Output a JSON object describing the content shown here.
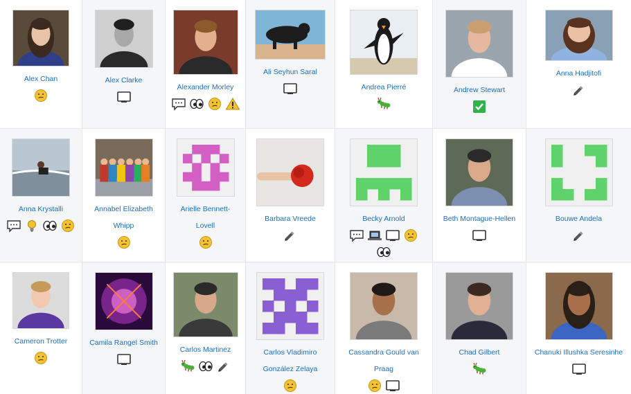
{
  "participants": [
    {
      "name": "Alex Chan",
      "icons": [
        "confused-face-icon"
      ]
    },
    {
      "name": "Alex Clarke",
      "icons": [
        "laptop-screen-icon"
      ]
    },
    {
      "name": "Alexander Morley",
      "icons": [
        "speech-bubble-icon",
        "eyes-icon",
        "confused-face-icon",
        "warning-icon"
      ]
    },
    {
      "name": "Ali Seyhun Saral",
      "icons": [
        "laptop-screen-icon"
      ]
    },
    {
      "name": "Andrea Pierré",
      "icons": [
        "bug-icon"
      ]
    },
    {
      "name": "Andrew Stewart",
      "icons": [
        "checkmark-icon"
      ]
    },
    {
      "name": "Anna Hadjitofi",
      "icons": [
        "pencil-icon"
      ]
    },
    {
      "name": "Anna Krystalli",
      "icons": [
        "speech-bubble-icon",
        "lightbulb-icon",
        "eyes-icon",
        "confused-face-icon"
      ]
    },
    {
      "name": "Annabel Elizabeth Whipp",
      "icons": [
        "confused-face-icon"
      ]
    },
    {
      "name": "Arielle Bennett-Lovell",
      "icons": [
        "confused-face-icon"
      ]
    },
    {
      "name": "Barbara Vreede",
      "icons": [
        "pencil-icon"
      ]
    },
    {
      "name": "Becky Arnold",
      "icons": [
        "speech-bubble-icon",
        "laptop-icon",
        "laptop-screen-icon",
        "confused-face-icon",
        "eyes-icon"
      ]
    },
    {
      "name": "Beth Montague-Hellen",
      "icons": [
        "laptop-screen-icon"
      ]
    },
    {
      "name": "Bouwe Andela",
      "icons": [
        "pencil-icon"
      ]
    },
    {
      "name": "Cameron Trotter",
      "icons": [
        "confused-face-icon"
      ]
    },
    {
      "name": "Camila Rangel Smith",
      "icons": [
        "laptop-screen-icon"
      ]
    },
    {
      "name": "Carlos Martinez",
      "icons": [
        "bug-icon",
        "eyes-icon",
        "pencil-icon"
      ]
    },
    {
      "name": "Carlos Vladimiro González Zelaya",
      "icons": [
        "confused-face-icon"
      ]
    },
    {
      "name": "Cassandra Gould van Praag",
      "icons": [
        "confused-face-icon",
        "laptop-screen-icon"
      ]
    },
    {
      "name": "Chad Gilbert",
      "icons": [
        "bug-icon"
      ]
    },
    {
      "name": "Chanuki Illushka Seresinhe",
      "icons": [
        "laptop-screen-icon"
      ]
    }
  ],
  "colors": {
    "link": "#1a6ec5",
    "identicon_pink": "#d35fc4",
    "identicon_green": "#5fd36a",
    "identicon_purple": "#8a5fd3",
    "check_green": "#2fb34a",
    "emoji_yellow": "#f4c430"
  }
}
